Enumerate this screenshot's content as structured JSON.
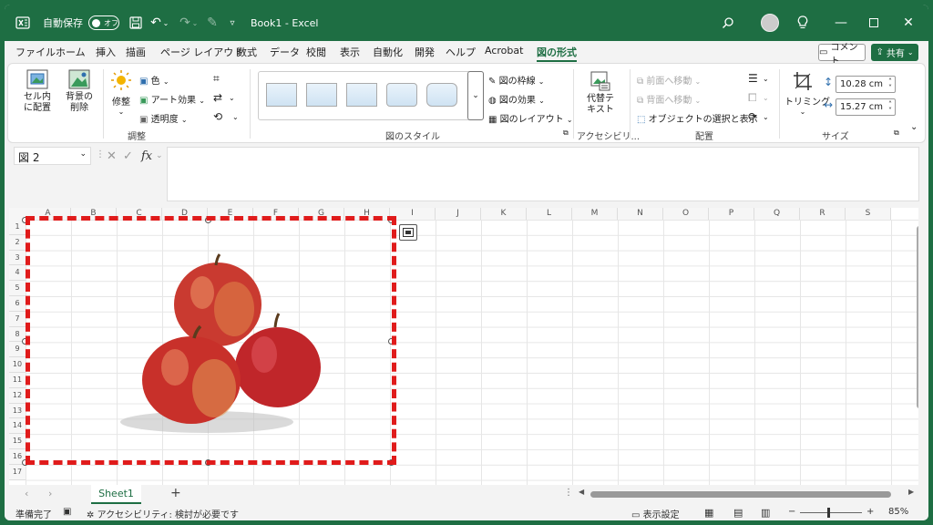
{
  "titlebar": {
    "autosave_label": "自動保存",
    "autosave_state": "オフ",
    "title": "Book1  -  Excel"
  },
  "tabs": [
    "ファイル",
    "ホーム",
    "挿入",
    "描画",
    "ページ レイアウト",
    "数式",
    "データ",
    "校閲",
    "表示",
    "自動化",
    "開発",
    "ヘルプ",
    "Acrobat",
    "図の形式"
  ],
  "active_tab": "図の形式",
  "comment_label": "コメント",
  "share_label": "共有",
  "ribbon": {
    "adjust": {
      "transparent_cell": "セル内\nに配置",
      "remove_bg": "背景の\n削除",
      "corrections": "修整",
      "color": "色",
      "artistic": "アート効果",
      "transparency": "透明度",
      "label": "調整"
    },
    "styles": {
      "border": "図の枠線",
      "effects": "図の効果",
      "layout": "図のレイアウト",
      "label": "図のスタイル"
    },
    "accessibility": {
      "alt_text": "代替テ\nキスト",
      "label": "アクセシビリ..."
    },
    "arrange": {
      "bring_forward": "前面へ移動",
      "send_backward": "背面へ移動",
      "selection_pane": "オブジェクトの選択と表示",
      "label": "配置"
    },
    "size": {
      "crop": "トリミング",
      "height": "10.28 cm",
      "width": "15.27 cm",
      "label": "サイズ"
    }
  },
  "formula_bar": {
    "name_box": "図 2",
    "fx": "fx",
    "value": ""
  },
  "columns": [
    "A",
    "B",
    "C",
    "D",
    "E",
    "F",
    "G",
    "H",
    "I",
    "J",
    "K",
    "L",
    "M",
    "N",
    "O",
    "P",
    "Q",
    "R",
    "S"
  ],
  "rows": [
    "1",
    "2",
    "3",
    "4",
    "5",
    "6",
    "7",
    "8",
    "9",
    "10",
    "11",
    "12",
    "13",
    "14",
    "15",
    "16",
    "17"
  ],
  "sheet_tab": "Sheet1",
  "statusbar": {
    "ready": "準備完了",
    "accessibility": "アクセシビリティ: 検討が必要です",
    "display_settings": "表示設定",
    "zoom": "85%"
  },
  "colors": {
    "brand": "#1e6e43",
    "highlight": "#e01b1b"
  }
}
